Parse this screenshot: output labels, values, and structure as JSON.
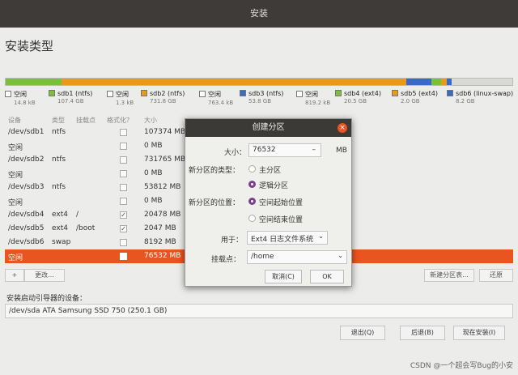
{
  "window": {
    "title": "安装"
  },
  "heading": "安装类型",
  "disk_colors": {
    "free": "#d9d9d6",
    "sdb1": "#7bbf3c",
    "sdb2": "#e89a1f",
    "sdb3": "#3a6bc4",
    "sdb4": "#7bbf3c",
    "sdb5": "#e89a1f",
    "sdb6": "#3a6bc4",
    "selected": "#e95420"
  },
  "legend": [
    {
      "name": "空闲",
      "size": "14.8 kB",
      "color_key": "free"
    },
    {
      "name": "sdb1 (ntfs)",
      "size": "107.4 GB",
      "color_key": "sdb1"
    },
    {
      "name": "空闲",
      "size": "1.3 kB",
      "color_key": "free"
    },
    {
      "name": "sdb2 (ntfs)",
      "size": "731.8 GB",
      "color_key": "sdb2"
    },
    {
      "name": "空闲",
      "size": "763.4 kB",
      "color_key": "free"
    },
    {
      "name": "sdb3 (ntfs)",
      "size": "53.8 GB",
      "color_key": "sdb3"
    },
    {
      "name": "空闲",
      "size": "819.2 kB",
      "color_key": "free"
    },
    {
      "name": "sdb4 (ext4)",
      "size": "20.5 GB",
      "color_key": "sdb4"
    },
    {
      "name": "sdb5 (ext4)",
      "size": "2.0 GB",
      "color_key": "sdb5"
    },
    {
      "name": "sdb6 (linux-swap)",
      "size": "8.2 GB",
      "color_key": "sdb6"
    }
  ],
  "table": {
    "headers": {
      "device": "设备",
      "type": "类型",
      "mount": "挂载点",
      "format": "格式化？",
      "size": "大小"
    },
    "rows": [
      {
        "device": "/dev/sdb1",
        "type": "ntfs",
        "mount": "",
        "format": "",
        "size": "107374 MB",
        "selected": false
      },
      {
        "device": "空闲",
        "type": "",
        "mount": "",
        "format": "",
        "size": "0 MB",
        "selected": false
      },
      {
        "device": "/dev/sdb2",
        "type": "ntfs",
        "mount": "",
        "format": "",
        "size": "731765 MB",
        "selected": false
      },
      {
        "device": "空闲",
        "type": "",
        "mount": "",
        "format": "",
        "size": "0 MB",
        "selected": false
      },
      {
        "device": "/dev/sdb3",
        "type": "ntfs",
        "mount": "",
        "format": "",
        "size": "53812 MB",
        "selected": false
      },
      {
        "device": "空闲",
        "type": "",
        "mount": "",
        "format": "",
        "size": "0 MB",
        "selected": false
      },
      {
        "device": "/dev/sdb4",
        "type": "ext4",
        "mount": "/",
        "format": "✓",
        "size": "20478 MB",
        "selected": false
      },
      {
        "device": "/dev/sdb5",
        "type": "ext4",
        "mount": "/boot",
        "format": "✓",
        "size": "2047 MB",
        "selected": false
      },
      {
        "device": "/dev/sdb6",
        "type": "swap",
        "mount": "",
        "format": "",
        "size": "8192 MB",
        "selected": false
      },
      {
        "device": "空闲",
        "type": "",
        "mount": "",
        "format": "",
        "size": "76532 MB",
        "selected": true
      }
    ]
  },
  "table_tools": {
    "add": "+",
    "change": "更改...",
    "new_table": "新建分区表...",
    "revert": "还原"
  },
  "bootloader": {
    "label": "安装启动引导器的设备：",
    "value": "/dev/sda   ATA Samsung SSD 750 (250.1 GB)"
  },
  "buttons": {
    "quit": "退出(Q)",
    "back": "后退(B)",
    "install": "现在安装(I)"
  },
  "dialog": {
    "title": "创建分区",
    "close": "×",
    "size_label": "大小：",
    "size_value": "76532",
    "size_spin": "–",
    "size_unit": "MB",
    "type_label": "新分区的类型：",
    "type_primary": "主分区",
    "type_logical": "逻辑分区",
    "location_label": "新分区的位置：",
    "location_start": "空间起始位置",
    "location_end": "空间结束位置",
    "use_label": "用于：",
    "use_value": "Ext4 日志文件系统",
    "mount_label": "挂载点：",
    "mount_value": "/home",
    "cancel": "取消(C)",
    "ok": "OK"
  },
  "watermark": "CSDN @一个超会写Bug的小安"
}
